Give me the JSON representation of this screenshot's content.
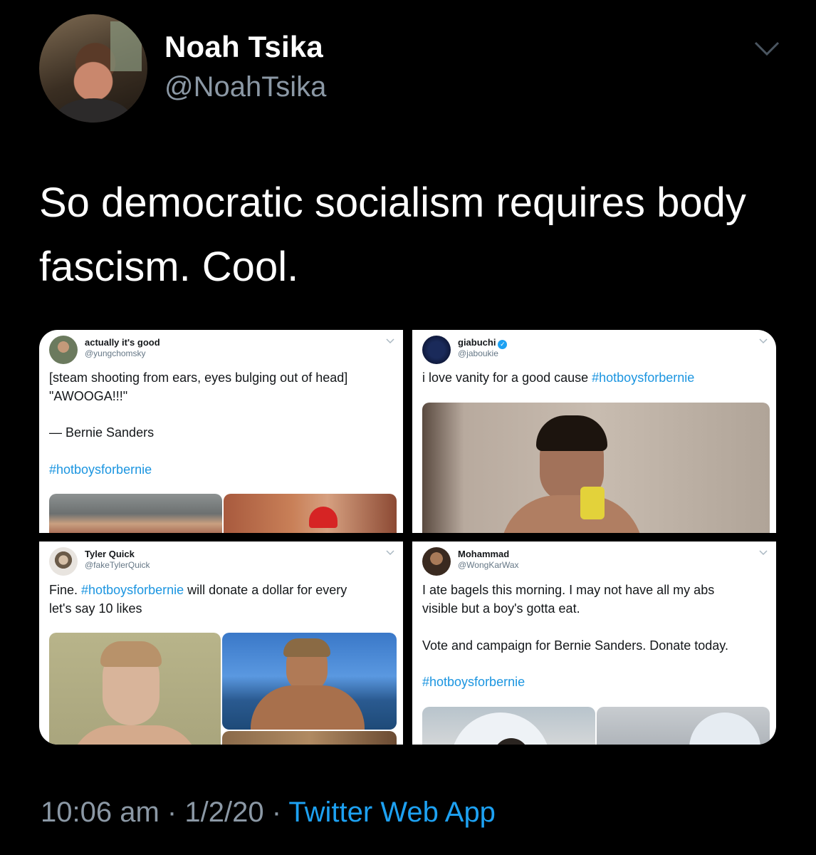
{
  "tweet": {
    "author": {
      "name": "Noah Tsika",
      "handle": "@NoahTsika"
    },
    "text_line1": "So democratic socialism requires body",
    "text_line2": "fascism. Cool.",
    "timestamp": "10:06 am",
    "date": "1/2/20",
    "source": "Twitter Web App",
    "separator": "·"
  },
  "embedded": [
    {
      "name": "actually it's good",
      "handle": "@yungchomsky",
      "lines": [
        "[steam shooting from ears, eyes bulging out of head]",
        "\"AWOOGA!!!\"",
        "— Bernie Sanders"
      ],
      "hashtag": "#hotboysforbernie"
    },
    {
      "name": "giabuchi",
      "handle": "@jaboukie",
      "text": "i love vanity for a good cause ",
      "hashtag": "#hotboysforbernie"
    },
    {
      "name": "Tyler Quick",
      "handle": "@fakeTylerQuick",
      "text_pre": "Fine. ",
      "hashtag": "#hotboysforbernie",
      "text_post": " will donate a dollar for every",
      "line2": "let's say 10 likes"
    },
    {
      "name": "Mohammad",
      "handle": "@WongKarWax",
      "line1": "I ate bagels this morning. I may not have all my abs",
      "line2": "visible but a boy's gotta eat.",
      "line3": "Vote and campaign for Bernie Sanders. Donate today.",
      "hashtag": "#hotboysforbernie"
    }
  ],
  "icons": {
    "caret": "chevron-down-icon",
    "verified": "verified-badge-icon"
  },
  "colors": {
    "background": "#000000",
    "secondary_text": "#8b98a5",
    "link": "#1da1f2"
  }
}
